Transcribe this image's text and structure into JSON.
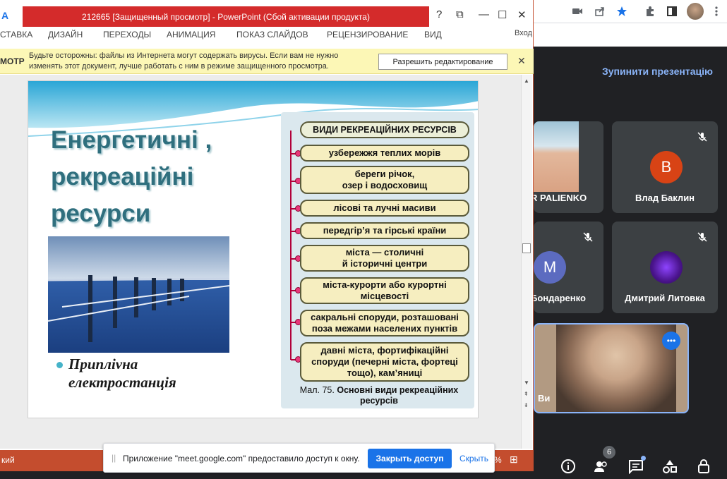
{
  "powerpoint": {
    "app_icon_text": "A",
    "window_title": "212665 [Защищенный просмотр] -  PowerPoint (Сбой активации продукта)",
    "title_buttons": [
      "?",
      "⧉",
      "—",
      "☐",
      "✕"
    ],
    "ribbon_tabs": [
      "СТАВКА",
      "ДИЗАЙН",
      "ПЕРЕХОДЫ",
      "АНИМАЦИЯ",
      "ПОКАЗ СЛАЙДОВ",
      "РЕЦЕНЗИРОВАНИЕ",
      "ВИД"
    ],
    "signin": "Вход",
    "protected_view": {
      "tag": "МОТР",
      "message_line1": "Будьте осторожны: файлы из Интернета могут содержать вирусы. Если вам не нужно",
      "message_line2": "изменять этот документ, лучше работать с ним в режиме защищенного просмотра.",
      "enable_button": "Разрешить редактирование"
    },
    "status": {
      "left": "кий",
      "zoom_suffix": "%"
    }
  },
  "slide": {
    "title_lines": [
      "Енергетичні ,",
      "рекреаційні",
      "ресурси"
    ],
    "caption_lines": [
      "Приплivна",
      "електростанція"
    ],
    "diagram": {
      "header": "ВИДИ РЕКРЕАЦІЙНИХ РЕСУРСІВ",
      "items": [
        "узбережжя теплих морів",
        "береги річок, озер і водосховищ",
        "лісові та лучні масиви",
        "передгір’я та гірські країни",
        "міста — столичні й історичні центри",
        "міста-курорти або курортні місцевості",
        "сакральні споруди, розташовані поза межами населених пунктів",
        "давні міста, фортифікаційні споруди (печерні міста, фортеці тощо), кам’яниці"
      ],
      "caption_prefix": "Мал. 75.",
      "caption_bold": "Основні види рекреаційних ресурсів"
    }
  },
  "meet": {
    "stop_presentation": "Зупинити презентацію",
    "participants": [
      {
        "name": "R PALIENKO",
        "type": "video"
      },
      {
        "name": "Влад Баклин",
        "initial": "B",
        "color": "#d84315",
        "muted": true
      },
      {
        "name": "Бондаренко",
        "initial": "M",
        "color": "#5c6bc0",
        "muted": true
      },
      {
        "name": "Дмитрий Литовка",
        "type": "image",
        "muted": true
      },
      {
        "name": "Ви",
        "type": "video-self"
      }
    ],
    "people_count": "6"
  },
  "share_banner": {
    "grip": "||",
    "text": "Приложение \"meet.google.com\" предоставило доступ к окну.",
    "stop_button": "Закрыть доступ",
    "hide_link": "Скрыть"
  }
}
